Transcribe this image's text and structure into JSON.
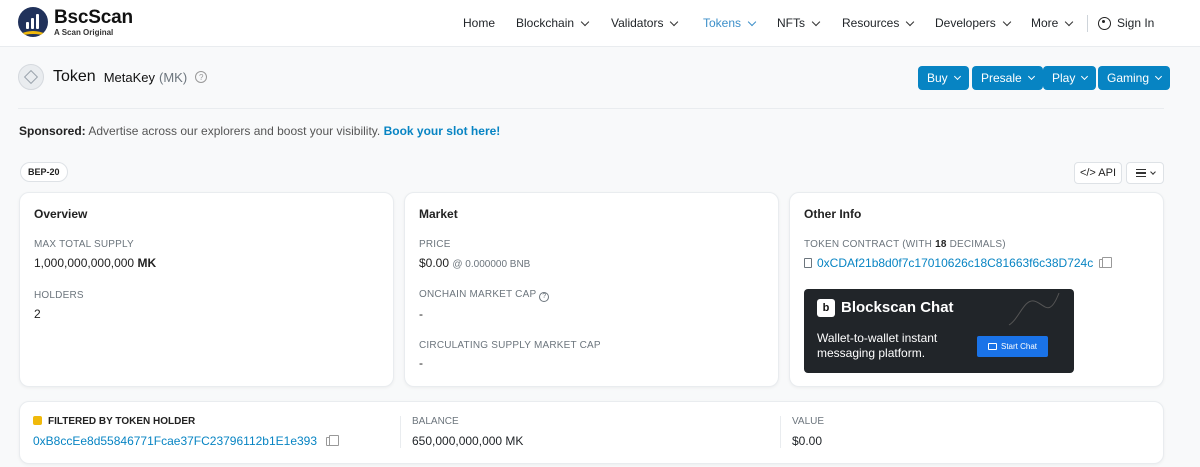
{
  "brand": {
    "name": "BscScan",
    "tagline": "A Scan Original"
  },
  "nav": {
    "items": [
      {
        "label": "Home",
        "dropdown": false
      },
      {
        "label": "Blockchain",
        "dropdown": true
      },
      {
        "label": "Validators",
        "dropdown": true
      },
      {
        "label": "Tokens",
        "dropdown": true,
        "active": true
      },
      {
        "label": "NFTs",
        "dropdown": true
      },
      {
        "label": "Resources",
        "dropdown": true
      },
      {
        "label": "Developers",
        "dropdown": true
      },
      {
        "label": "More",
        "dropdown": true
      }
    ],
    "sign_in": "Sign In",
    "active_color": "#3d8fc9"
  },
  "token": {
    "heading": "Token",
    "name": "MetaKey",
    "symbol": "(MK)",
    "help": "?"
  },
  "actions": [
    "Buy",
    "Presale",
    "Play",
    "Gaming"
  ],
  "accent_color": "#0784c3",
  "sponsored": {
    "label": "Sponsored:",
    "text": " Advertise across our explorers and boost your visibility. ",
    "link": "Book your slot here!"
  },
  "badge": "BEP-20",
  "api_label": "</> API",
  "overview": {
    "title": "Overview",
    "max_supply_label": "MAX TOTAL SUPPLY",
    "max_supply_value": "1,000,000,000,000",
    "max_supply_unit": "MK",
    "holders_label": "HOLDERS",
    "holders_value": "2"
  },
  "market": {
    "title": "Market",
    "price_label": "PRICE",
    "price_value": "$0.00",
    "price_bnb": "@ 0.000000 BNB",
    "mcap_label": "ONCHAIN MARKET CAP",
    "mcap_value": "-",
    "circ_label": "CIRCULATING SUPPLY MARKET CAP",
    "circ_value": "-"
  },
  "other_info": {
    "title": "Other Info",
    "contract_label_pre": "TOKEN CONTRACT (WITH ",
    "contract_decimals": "18",
    "contract_label_post": " DECIMALS)",
    "contract_address": "0xCDAf21b8d0f7c17010626c18C81663f6c38D724c"
  },
  "chat_ad": {
    "logo": "b",
    "title": "Blockscan Chat",
    "desc": "Wallet-to-wallet instant messaging platform.",
    "button": "Start Chat"
  },
  "filter": {
    "label": "FILTERED BY TOKEN HOLDER",
    "address": "0xB8ccEe8d55846771Fcae37FC23796112b1E1e393",
    "balance_label": "BALANCE",
    "balance_value": "650,000,000,000 MK",
    "value_label": "VALUE",
    "value_value": "$0.00"
  }
}
